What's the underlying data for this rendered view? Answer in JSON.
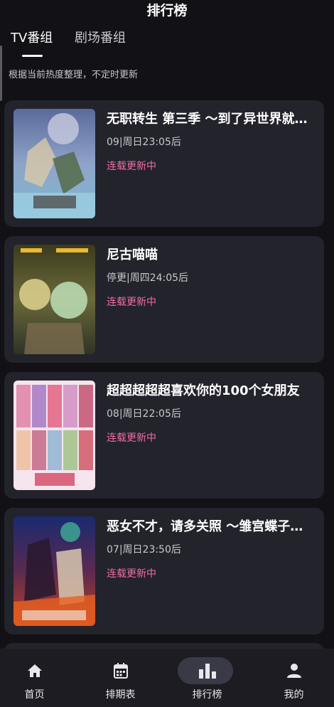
{
  "header": {
    "title": "排行榜"
  },
  "tabs": [
    {
      "label": "TV番组",
      "active": true
    },
    {
      "label": "剧场番组",
      "active": false
    }
  ],
  "subtitle": "根据当前热度整理，不定时更新",
  "items": [
    {
      "title": "无职转生 第三季 ～到了异世界就拿出真本事～",
      "schedule": "09|周日23:05后",
      "status": "连载更新中",
      "cover_icon": "anime-cover-art"
    },
    {
      "title": "尼古喵喵",
      "schedule": "停更|周四24:05后",
      "status": "连载更新中",
      "cover_icon": "anime-cover-art"
    },
    {
      "title": "超超超超超喜欢你的100个女朋友",
      "schedule": "08|周日22:05后",
      "status": "连载更新中",
      "cover_icon": "anime-cover-art"
    },
    {
      "title": "恶女不才，请多关照 ～雏宫蝶子的反击～",
      "schedule": "07|周日23:50后",
      "status": "连载更新中",
      "cover_icon": "anime-cover-art"
    }
  ],
  "nav": [
    {
      "label": "首页",
      "icon": "home-icon",
      "active": false
    },
    {
      "label": "排期表",
      "icon": "calendar-icon",
      "active": false
    },
    {
      "label": "排行榜",
      "icon": "bar-chart-icon",
      "active": true
    },
    {
      "label": "我的",
      "icon": "person-icon",
      "active": false
    }
  ],
  "colors": {
    "background": "#111116",
    "card": "#23232b",
    "status": "#f06ca6",
    "nav_pill": "#3a3a46"
  }
}
